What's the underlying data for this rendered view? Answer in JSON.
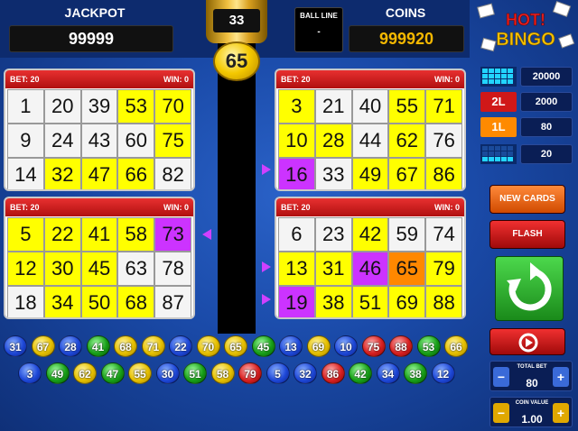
{
  "header": {
    "jackpot_label": "JACKPOT",
    "jackpot_value": "99999",
    "coins_label": "COINS",
    "coins_value": "999920",
    "ball_line_label": "BALL LINE",
    "ball_line_value": "-",
    "ball_counter": "33",
    "current_ball": "65",
    "logo_text_top": "HOT!",
    "logo_text_bottom": "BINGO"
  },
  "cards": [
    {
      "bet_label": "BET: 20",
      "win_label": "WIN: 0",
      "cells": [
        {
          "n": "1",
          "c": "w"
        },
        {
          "n": "20",
          "c": "w"
        },
        {
          "n": "39",
          "c": "w"
        },
        {
          "n": "53",
          "c": "y"
        },
        {
          "n": "70",
          "c": "y"
        },
        {
          "n": "9",
          "c": "w"
        },
        {
          "n": "24",
          "c": "w"
        },
        {
          "n": "43",
          "c": "w"
        },
        {
          "n": "60",
          "c": "w"
        },
        {
          "n": "75",
          "c": "y"
        },
        {
          "n": "14",
          "c": "w"
        },
        {
          "n": "32",
          "c": "y"
        },
        {
          "n": "47",
          "c": "y"
        },
        {
          "n": "66",
          "c": "y"
        },
        {
          "n": "82",
          "c": "w"
        }
      ]
    },
    {
      "bet_label": "BET: 20",
      "win_label": "WIN: 0",
      "cells": [
        {
          "n": "3",
          "c": "y"
        },
        {
          "n": "21",
          "c": "w"
        },
        {
          "n": "40",
          "c": "w"
        },
        {
          "n": "55",
          "c": "y"
        },
        {
          "n": "71",
          "c": "y"
        },
        {
          "n": "10",
          "c": "y"
        },
        {
          "n": "28",
          "c": "y"
        },
        {
          "n": "44",
          "c": "w"
        },
        {
          "n": "62",
          "c": "y"
        },
        {
          "n": "76",
          "c": "w"
        },
        {
          "n": "16",
          "c": "p"
        },
        {
          "n": "33",
          "c": "w"
        },
        {
          "n": "49",
          "c": "y"
        },
        {
          "n": "67",
          "c": "y"
        },
        {
          "n": "86",
          "c": "y"
        }
      ]
    },
    {
      "bet_label": "BET: 20",
      "win_label": "WIN: 0",
      "cells": [
        {
          "n": "5",
          "c": "y"
        },
        {
          "n": "22",
          "c": "y"
        },
        {
          "n": "41",
          "c": "y"
        },
        {
          "n": "58",
          "c": "y"
        },
        {
          "n": "73",
          "c": "p"
        },
        {
          "n": "12",
          "c": "y"
        },
        {
          "n": "30",
          "c": "y"
        },
        {
          "n": "45",
          "c": "y"
        },
        {
          "n": "63",
          "c": "w"
        },
        {
          "n": "78",
          "c": "w"
        },
        {
          "n": "18",
          "c": "w"
        },
        {
          "n": "34",
          "c": "y"
        },
        {
          "n": "50",
          "c": "y"
        },
        {
          "n": "68",
          "c": "y"
        },
        {
          "n": "87",
          "c": "w"
        }
      ]
    },
    {
      "bet_label": "BET: 20",
      "win_label": "WIN: 0",
      "cells": [
        {
          "n": "6",
          "c": "w"
        },
        {
          "n": "23",
          "c": "w"
        },
        {
          "n": "42",
          "c": "y"
        },
        {
          "n": "59",
          "c": "w"
        },
        {
          "n": "74",
          "c": "w"
        },
        {
          "n": "13",
          "c": "y"
        },
        {
          "n": "31",
          "c": "y"
        },
        {
          "n": "46",
          "c": "p"
        },
        {
          "n": "65",
          "c": "o"
        },
        {
          "n": "79",
          "c": "y"
        },
        {
          "n": "19",
          "c": "p"
        },
        {
          "n": "38",
          "c": "y"
        },
        {
          "n": "51",
          "c": "y"
        },
        {
          "n": "69",
          "c": "y"
        },
        {
          "n": "88",
          "c": "y"
        }
      ]
    }
  ],
  "paytable": [
    {
      "icon": "full-card-pattern-icon",
      "value": "20000"
    },
    {
      "icon": "two-line-icon",
      "badge": "2L",
      "value": "2000"
    },
    {
      "icon": "one-line-icon",
      "badge": "1L",
      "value": "80"
    },
    {
      "icon": "bottom-line-pattern-icon",
      "value": "20"
    }
  ],
  "buttons": {
    "new_cards": "NEW CARDS",
    "flash": "FLASH"
  },
  "controls": {
    "total_bet_label": "TOTAL BET",
    "total_bet_value": "80",
    "coin_value_label": "COIN VALUE",
    "coin_value_value": "1.00",
    "minus": "−",
    "plus": "+"
  },
  "drawn_balls_row1": [
    {
      "n": "31",
      "c": "blue"
    },
    {
      "n": "67",
      "c": "yellow"
    },
    {
      "n": "28",
      "c": "blue"
    },
    {
      "n": "41",
      "c": "green"
    },
    {
      "n": "68",
      "c": "yellow"
    },
    {
      "n": "71",
      "c": "yellow"
    },
    {
      "n": "22",
      "c": "blue"
    },
    {
      "n": "70",
      "c": "yellow"
    },
    {
      "n": "65",
      "c": "yellow"
    },
    {
      "n": "45",
      "c": "green"
    },
    {
      "n": "13",
      "c": "blue"
    },
    {
      "n": "69",
      "c": "yellow"
    },
    {
      "n": "10",
      "c": "blue"
    },
    {
      "n": "75",
      "c": "red"
    },
    {
      "n": "88",
      "c": "red"
    },
    {
      "n": "53",
      "c": "green"
    },
    {
      "n": "66",
      "c": "yellow"
    }
  ],
  "drawn_balls_row2": [
    {
      "n": "3",
      "c": "blue"
    },
    {
      "n": "49",
      "c": "green"
    },
    {
      "n": "62",
      "c": "yellow"
    },
    {
      "n": "47",
      "c": "green"
    },
    {
      "n": "55",
      "c": "yellow"
    },
    {
      "n": "30",
      "c": "blue"
    },
    {
      "n": "51",
      "c": "green"
    },
    {
      "n": "58",
      "c": "yellow"
    },
    {
      "n": "79",
      "c": "red"
    },
    {
      "n": "5",
      "c": "blue"
    },
    {
      "n": "32",
      "c": "blue"
    },
    {
      "n": "86",
      "c": "red"
    },
    {
      "n": "42",
      "c": "green"
    },
    {
      "n": "34",
      "c": "blue"
    },
    {
      "n": "38",
      "c": "green"
    },
    {
      "n": "12",
      "c": "blue"
    }
  ],
  "colors": {
    "background": "#1a4aa8",
    "card_header": "#d02020",
    "marked_yellow": "#ffff00",
    "marked_purple": "#cc33ff",
    "marked_orange": "#ff8800",
    "gold": "#f5b800"
  }
}
